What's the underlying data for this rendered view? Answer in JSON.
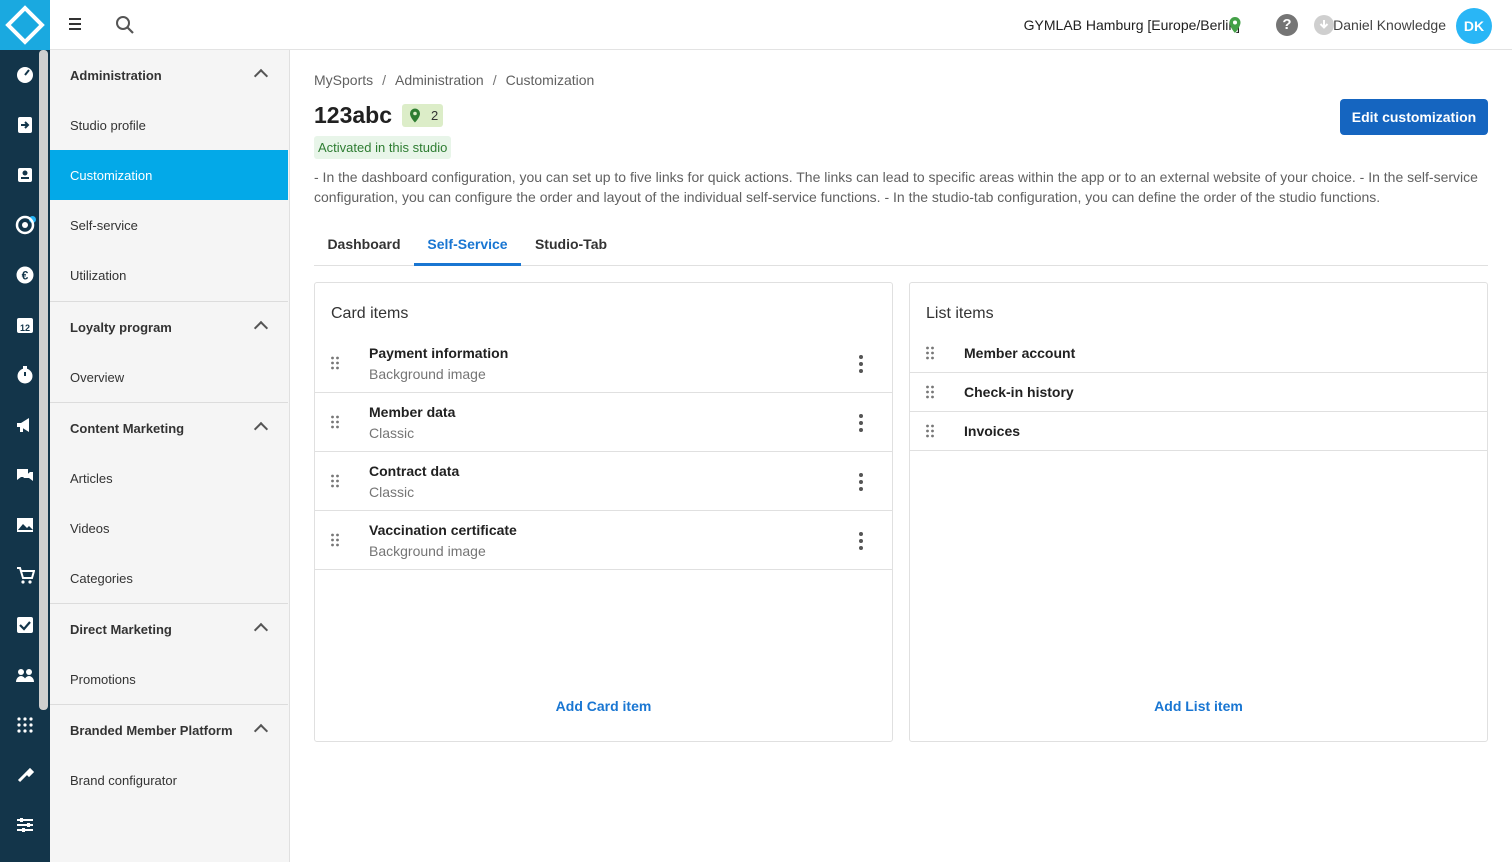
{
  "topbar": {
    "studio": "GYMLAB Hamburg [Europe/Berlin]",
    "user": "Daniel Knowledge",
    "avatar_initials": "DK",
    "help_symbol": "?"
  },
  "rail": {
    "icons": [
      "dashboard-icon",
      "login-icon",
      "members-icon",
      "services-icon",
      "finance-icon",
      "calendar-icon",
      "timer-icon",
      "marketing-icon",
      "chat-icon",
      "gallery-icon",
      "shop-icon",
      "tasks-icon",
      "groups-icon",
      "network-icon",
      "tools-icon",
      "settings-icon"
    ]
  },
  "sidebar": {
    "sections": [
      {
        "title": "Administration",
        "items": [
          "Studio profile",
          "Customization",
          "Self-service",
          "Utilization"
        ]
      },
      {
        "title": "Loyalty program",
        "items": [
          "Overview"
        ]
      },
      {
        "title": "Content Marketing",
        "items": [
          "Articles",
          "Videos",
          "Categories"
        ]
      },
      {
        "title": "Direct Marketing",
        "items": [
          "Promotions"
        ]
      },
      {
        "title": "Branded Member Platform",
        "items": [
          "Brand configurator"
        ]
      }
    ],
    "active_item": "Customization"
  },
  "breadcrumb": [
    "MySports",
    "Administration",
    "Customization"
  ],
  "page": {
    "title": "123abc",
    "badge_count": "2",
    "status": "Activated in this studio",
    "edit_button": "Edit customization",
    "description": "- In the dashboard configuration, you can set up to five links for quick actions. The links can lead to specific areas within the app or to an external website of your choice. - In the self-service configuration, you can configure the order and layout of the individual self-service functions. - In the studio-tab configuration, you can define the order of the studio functions."
  },
  "tabs": [
    {
      "label": "Dashboard",
      "active": false
    },
    {
      "label": "Self-Service",
      "active": true
    },
    {
      "label": "Studio-Tab",
      "active": false
    }
  ],
  "card_items": {
    "title": "Card items",
    "rows": [
      {
        "name": "Payment information",
        "layout": "Background image"
      },
      {
        "name": "Member data",
        "layout": "Classic"
      },
      {
        "name": "Contract data",
        "layout": "Classic"
      },
      {
        "name": "Vaccination certificate",
        "layout": "Background image"
      }
    ],
    "add_label": "Add Card item"
  },
  "list_items": {
    "title": "List items",
    "rows": [
      "Member account",
      "Check-in history",
      "Invoices"
    ],
    "add_label": "Add List item"
  },
  "colors": {
    "rail_bg": "#13354a",
    "logo_bg": "#1aa9e0",
    "active_nav": "#03a9e8",
    "primary": "#1565c0",
    "link": "#1976d2",
    "status_bg": "#e8f5e9",
    "status_text": "#2e7d32"
  }
}
